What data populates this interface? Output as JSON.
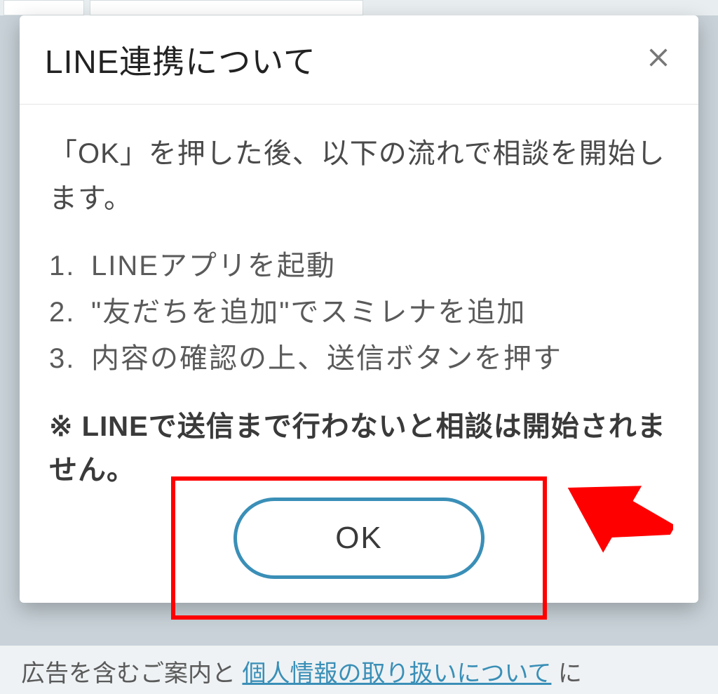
{
  "modal": {
    "title": "LINE連携について",
    "intro": "「OK」を押した後、以下の流れで相談を開始します。",
    "steps": [
      "LINEアプリを起動",
      "\"友だちを追加\"でスミレナを追加",
      "内容の確認の上、送信ボタンを押す"
    ],
    "warning": "※ LINEで送信まで行わないと相談は開始されません。",
    "ok_label": "OK"
  },
  "backdrop": {
    "text_left": "広告を含むご案内と",
    "text_link": "個人情報の取り扱いについて",
    "text_right": "に"
  },
  "annotation": {
    "highlight_color": "#ff0000",
    "arrow_color": "#ff0000"
  }
}
